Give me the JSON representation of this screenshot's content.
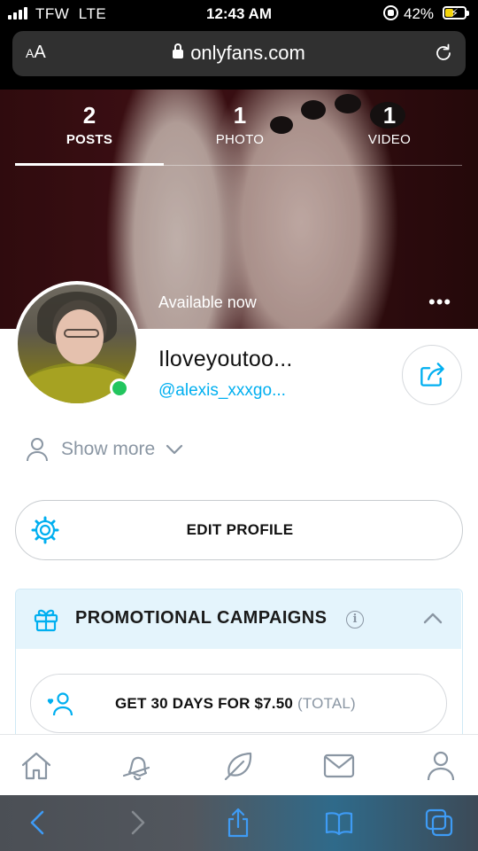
{
  "status_bar": {
    "carrier": "TFW",
    "network": "LTE",
    "time": "12:43 AM",
    "battery_percent": "42%",
    "battery_level": 0.42
  },
  "browser": {
    "text_size_label_small": "A",
    "text_size_label_large": "A",
    "url": "onlyfans.com"
  },
  "profile_stats": [
    {
      "count": "2",
      "label": "POSTS",
      "active": true
    },
    {
      "count": "1",
      "label": "PHOTO",
      "active": false
    },
    {
      "count": "1",
      "label": "VIDEO",
      "active": false
    }
  ],
  "cover": {
    "availability": "Available now",
    "more_glyph": "•••"
  },
  "profile": {
    "display_name": "Iloveyoutoo...",
    "username": "@alexis_xxxgo...",
    "show_more": "Show more"
  },
  "edit_profile": {
    "label": "EDIT PROFILE"
  },
  "promotions": {
    "title": "PROMOTIONAL CAMPAIGNS",
    "info_glyph": "i",
    "offer_main": "GET 30 DAYS FOR $7.50",
    "offer_suffix": "(TOTAL)"
  },
  "bottom_nav": [
    "home-icon",
    "notifications-icon",
    "feed-leaf-icon",
    "messages-icon",
    "profile-icon"
  ],
  "safari_toolbar": [
    "back-icon",
    "forward-icon",
    "share-icon",
    "bookmarks-icon",
    "tabs-icon"
  ],
  "colors": {
    "accent": "#00aff0",
    "online": "#22c55e",
    "muted": "#8a96a3",
    "promo_header_bg": "#e4f4fc"
  }
}
